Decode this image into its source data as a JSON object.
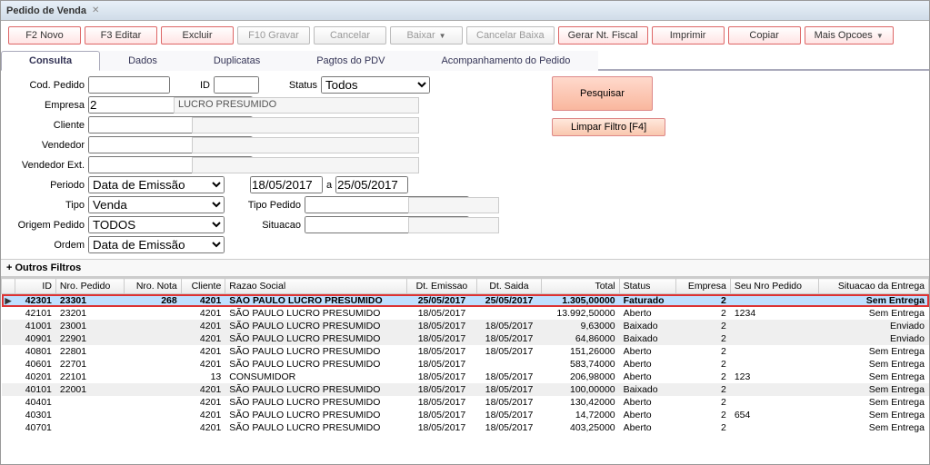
{
  "window": {
    "title": "Pedido de Venda"
  },
  "toolbar": {
    "novo": "F2 Novo",
    "editar": "F3 Editar",
    "excluir": "Excluir",
    "gravar": "F10 Gravar",
    "cancelar": "Cancelar",
    "baixar": "Baixar",
    "cancelar_baixa": "Cancelar Baixa",
    "gerar_nf": "Gerar Nt. Fiscal",
    "imprimir": "Imprimir",
    "copiar": "Copiar",
    "mais": "Mais Opcoes"
  },
  "tabs": {
    "consulta": "Consulta",
    "dados": "Dados",
    "duplicatas": "Duplicatas",
    "pagtos": "Pagtos do PDV",
    "acompanhamento": "Acompanhamento do Pedido"
  },
  "form": {
    "cod_pedido_lbl": "Cod. Pedido",
    "id_lbl": "ID",
    "status_lbl": "Status",
    "status_val": "Todos",
    "empresa_lbl": "Empresa",
    "empresa_val": "2",
    "empresa_nome": "LUCRO PRESUMIDO",
    "cliente_lbl": "Cliente",
    "vendedor_lbl": "Vendedor",
    "vendedor_ext_lbl": "Vendedor Ext.",
    "periodo_lbl": "Periodo",
    "periodo_tipo": "Data de Emissão",
    "periodo_ini": "18/05/2017",
    "periodo_a": "a",
    "periodo_fim": "25/05/2017",
    "tipo_lbl": "Tipo",
    "tipo_val": "Venda",
    "tipo_pedido_lbl": "Tipo Pedido",
    "origem_lbl": "Origem Pedido",
    "origem_val": "TODOS",
    "situacao_lbl": "Situacao",
    "ordem_lbl": "Ordem",
    "ordem_val": "Data de Emissão",
    "pesquisar": "Pesquisar",
    "limpar": "Limpar Filtro [F4]"
  },
  "section": {
    "outros_filtros": "+ Outros Filtros"
  },
  "grid": {
    "headers": {
      "id": "ID",
      "nro_pedido": "Nro. Pedido",
      "nro_nota": "Nro. Nota",
      "cliente": "Cliente",
      "razao": "Razao Social",
      "emissao": "Dt. Emissao",
      "saida": "Dt. Saida",
      "total": "Total",
      "status": "Status",
      "empresa": "Empresa",
      "seu_nro": "Seu Nro Pedido",
      "entrega": "Situacao da Entrega"
    },
    "rows": [
      {
        "id": "42301",
        "nro_pedido": "23301",
        "nro_nota": "268",
        "cliente": "4201",
        "razao": "SÃO PAULO LUCRO PRESUMIDO",
        "emissao": "25/05/2017",
        "saida": "25/05/2017",
        "total": "1.305,00000",
        "status": "Faturado",
        "empresa": "2",
        "seu_nro": "",
        "entrega": "Sem Entrega",
        "sel": true
      },
      {
        "id": "42101",
        "nro_pedido": "23201",
        "nro_nota": "",
        "cliente": "4201",
        "razao": "SÃO PAULO LUCRO PRESUMIDO",
        "emissao": "18/05/2017",
        "saida": "",
        "total": "13.992,50000",
        "status": "Aberto",
        "empresa": "2",
        "seu_nro": "1234",
        "entrega": "Sem Entrega"
      },
      {
        "id": "41001",
        "nro_pedido": "23001",
        "nro_nota": "",
        "cliente": "4201",
        "razao": "SÃO PAULO LUCRO PRESUMIDO",
        "emissao": "18/05/2017",
        "saida": "18/05/2017",
        "total": "9,63000",
        "status": "Baixado",
        "empresa": "2",
        "seu_nro": "",
        "entrega": "Enviado",
        "alt": true
      },
      {
        "id": "40901",
        "nro_pedido": "22901",
        "nro_nota": "",
        "cliente": "4201",
        "razao": "SÃO PAULO LUCRO PRESUMIDO",
        "emissao": "18/05/2017",
        "saida": "18/05/2017",
        "total": "64,86000",
        "status": "Baixado",
        "empresa": "2",
        "seu_nro": "",
        "entrega": "Enviado",
        "alt": true
      },
      {
        "id": "40801",
        "nro_pedido": "22801",
        "nro_nota": "",
        "cliente": "4201",
        "razao": "SÃO PAULO LUCRO PRESUMIDO",
        "emissao": "18/05/2017",
        "saida": "18/05/2017",
        "total": "151,26000",
        "status": "Aberto",
        "empresa": "2",
        "seu_nro": "",
        "entrega": "Sem Entrega"
      },
      {
        "id": "40601",
        "nro_pedido": "22701",
        "nro_nota": "",
        "cliente": "4201",
        "razao": "SÃO PAULO LUCRO PRESUMIDO",
        "emissao": "18/05/2017",
        "saida": "",
        "total": "583,74000",
        "status": "Aberto",
        "empresa": "2",
        "seu_nro": "",
        "entrega": "Sem Entrega"
      },
      {
        "id": "40201",
        "nro_pedido": "22101",
        "nro_nota": "",
        "cliente": "13",
        "razao": "CONSUMIDOR",
        "emissao": "18/05/2017",
        "saida": "18/05/2017",
        "total": "206,98000",
        "status": "Aberto",
        "empresa": "2",
        "seu_nro": "123",
        "entrega": "Sem Entrega"
      },
      {
        "id": "40101",
        "nro_pedido": "22001",
        "nro_nota": "",
        "cliente": "4201",
        "razao": "SÃO PAULO LUCRO PRESUMIDO",
        "emissao": "18/05/2017",
        "saida": "18/05/2017",
        "total": "100,00000",
        "status": "Baixado",
        "empresa": "2",
        "seu_nro": "",
        "entrega": "Sem Entrega",
        "alt": true
      },
      {
        "id": "40401",
        "nro_pedido": "",
        "nro_nota": "",
        "cliente": "4201",
        "razao": "SÃO PAULO LUCRO PRESUMIDO",
        "emissao": "18/05/2017",
        "saida": "18/05/2017",
        "total": "130,42000",
        "status": "Aberto",
        "empresa": "2",
        "seu_nro": "",
        "entrega": "Sem Entrega"
      },
      {
        "id": "40301",
        "nro_pedido": "",
        "nro_nota": "",
        "cliente": "4201",
        "razao": "SÃO PAULO LUCRO PRESUMIDO",
        "emissao": "18/05/2017",
        "saida": "18/05/2017",
        "total": "14,72000",
        "status": "Aberto",
        "empresa": "2",
        "seu_nro": "654",
        "entrega": "Sem Entrega"
      },
      {
        "id": "40701",
        "nro_pedido": "",
        "nro_nota": "",
        "cliente": "4201",
        "razao": "SÃO PAULO LUCRO PRESUMIDO",
        "emissao": "18/05/2017",
        "saida": "18/05/2017",
        "total": "403,25000",
        "status": "Aberto",
        "empresa": "2",
        "seu_nro": "",
        "entrega": "Sem Entrega"
      }
    ]
  }
}
